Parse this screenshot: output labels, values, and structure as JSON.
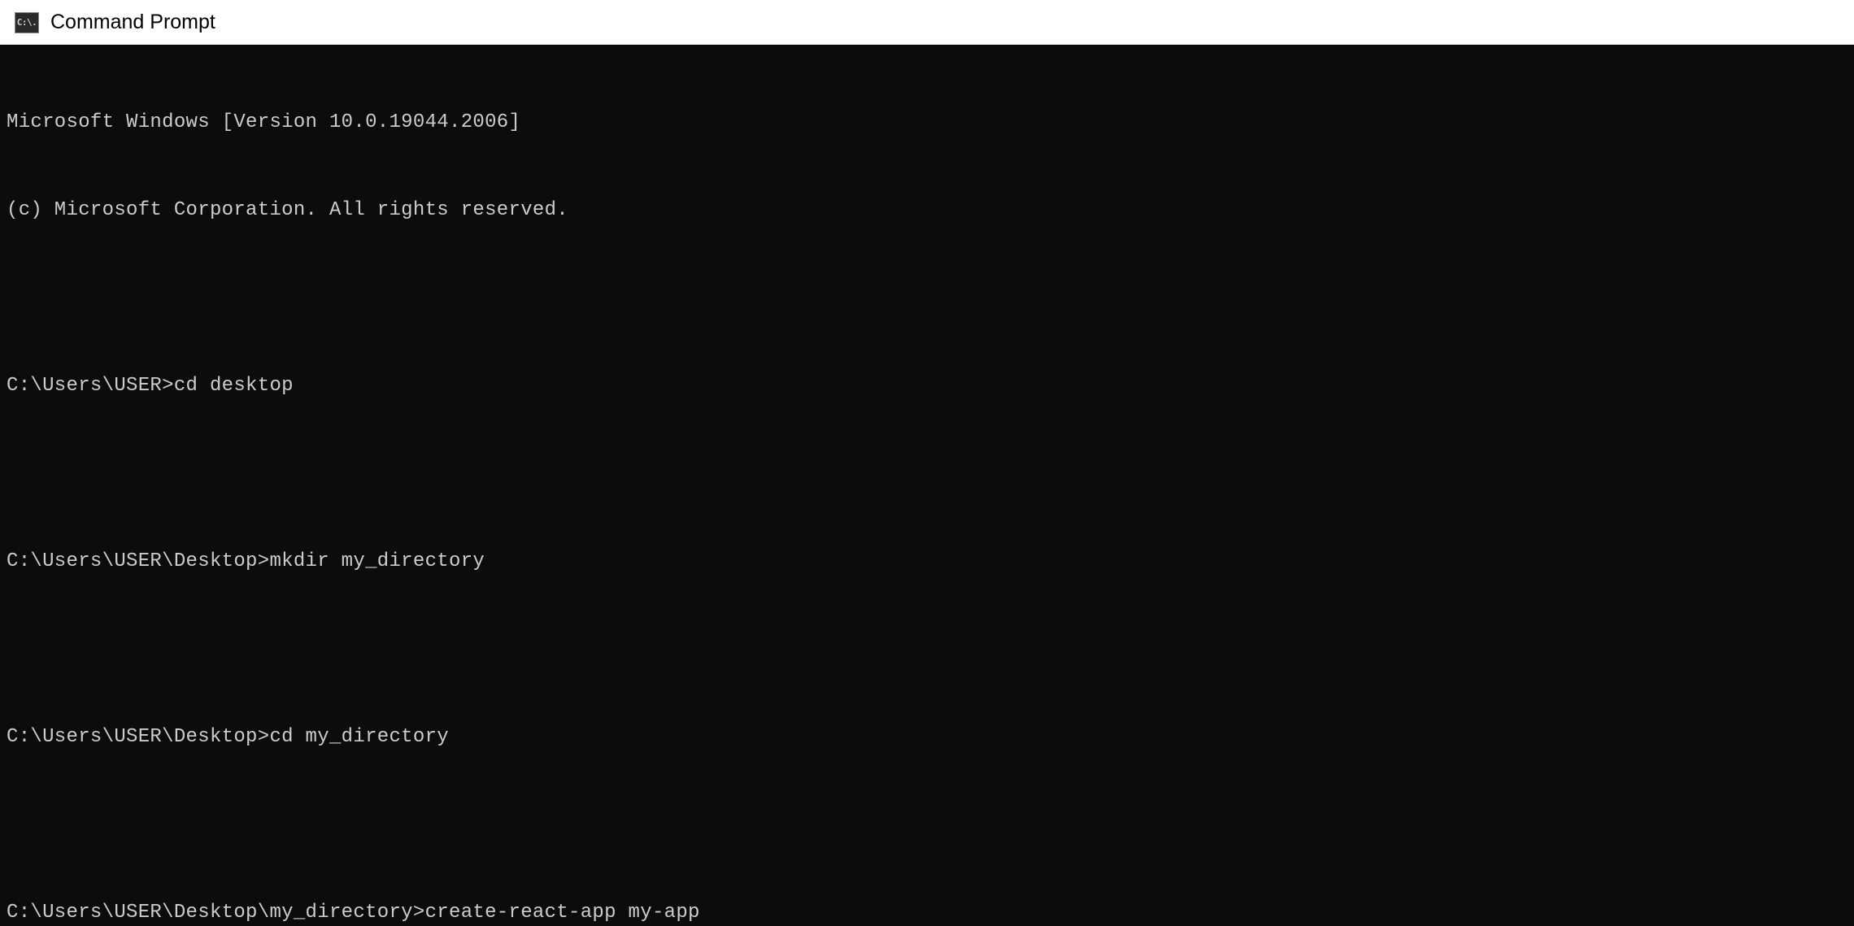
{
  "window": {
    "title": "Command Prompt",
    "icon_label": "C:\\."
  },
  "terminal": {
    "header_lines": [
      "Microsoft Windows [Version 10.0.19044.2006]",
      "(c) Microsoft Corporation. All rights reserved."
    ],
    "entries": [
      {
        "prompt": "C:\\Users\\USER>",
        "command": "cd desktop"
      },
      {
        "prompt": "C:\\Users\\USER\\Desktop>",
        "command": "mkdir my_directory"
      },
      {
        "prompt": "C:\\Users\\USER\\Desktop>",
        "command": "cd my_directory"
      },
      {
        "prompt": "C:\\Users\\USER\\Desktop\\my_directory>",
        "command": "create-react-app my-app"
      }
    ]
  }
}
